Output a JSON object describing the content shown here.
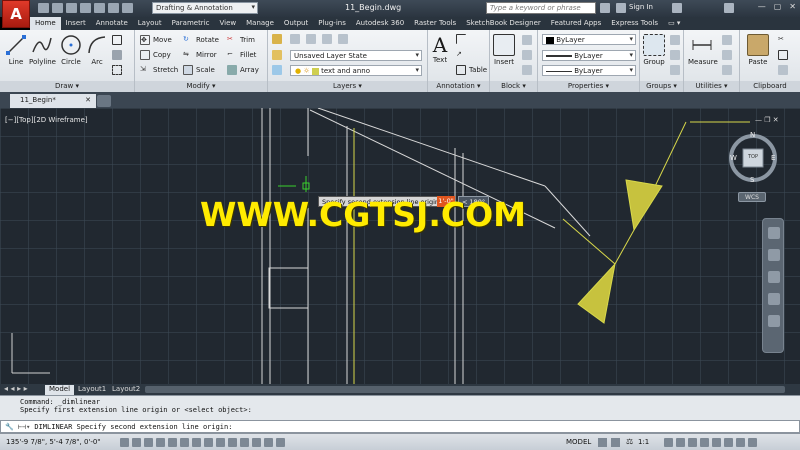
{
  "title_bar": {
    "workspace": "Drafting & Annotation",
    "doc_title": "11_Begin.dwg",
    "search_placeholder": "Type a keyword or phrase",
    "signin": "Sign In"
  },
  "ribbon_tabs": [
    "Home",
    "Insert",
    "Annotate",
    "Layout",
    "Parametric",
    "View",
    "Manage",
    "Output",
    "Plug-ins",
    "Autodesk 360",
    "Raster Tools",
    "SketchBook Designer",
    "Featured Apps",
    "Express Tools"
  ],
  "draw": {
    "title": "Draw",
    "line": "Line",
    "polyline": "Polyline",
    "circle": "Circle",
    "arc": "Arc"
  },
  "modify": {
    "title": "Modify",
    "move": "Move",
    "rotate": "Rotate",
    "trim": "Trim",
    "copy": "Copy",
    "mirror": "Mirror",
    "fillet": "Fillet",
    "stretch": "Stretch",
    "scale": "Scale",
    "array": "Array"
  },
  "layers": {
    "title": "Layers",
    "state": "Unsaved Layer State",
    "current": "text and anno"
  },
  "annotation": {
    "title": "Annotation",
    "text": "Text",
    "table": "Table"
  },
  "block": {
    "title": "Block",
    "insert": "Insert"
  },
  "properties": {
    "title": "Properties",
    "color": "ByLayer",
    "linetype": "ByLayer",
    "lineweight": "ByLayer"
  },
  "groups": {
    "title": "Groups",
    "group": "Group"
  },
  "utilities": {
    "title": "Utilities",
    "measure": "Measure"
  },
  "clipboard": {
    "title": "Clipboard",
    "paste": "Paste"
  },
  "doc_tab": "11_Begin*",
  "viewport_label": "[−][Top][2D Wireframe]",
  "viewcube": {
    "n": "N",
    "s": "S",
    "e": "E",
    "w": "W",
    "top": "TOP",
    "wcs": "WCS"
  },
  "tooltip": {
    "prompt": "Specify second extension line origin:",
    "value": "1'-0\"",
    "angle": "< 180°"
  },
  "watermark": "WWW.CGTSJ.COM",
  "layout_tabs": [
    "Model",
    "Layout1",
    "Layout2"
  ],
  "command_history": [
    "Command: _dimlinear",
    "Specify first extension line origin or <select object>:"
  ],
  "command_line": "DIMLINEAR Specify second extension line origin:",
  "status": {
    "coords": "135'-9 7/8\", 5'-4 7/8\", 0'-0\"",
    "model": "MODEL",
    "scale": "1:1"
  }
}
